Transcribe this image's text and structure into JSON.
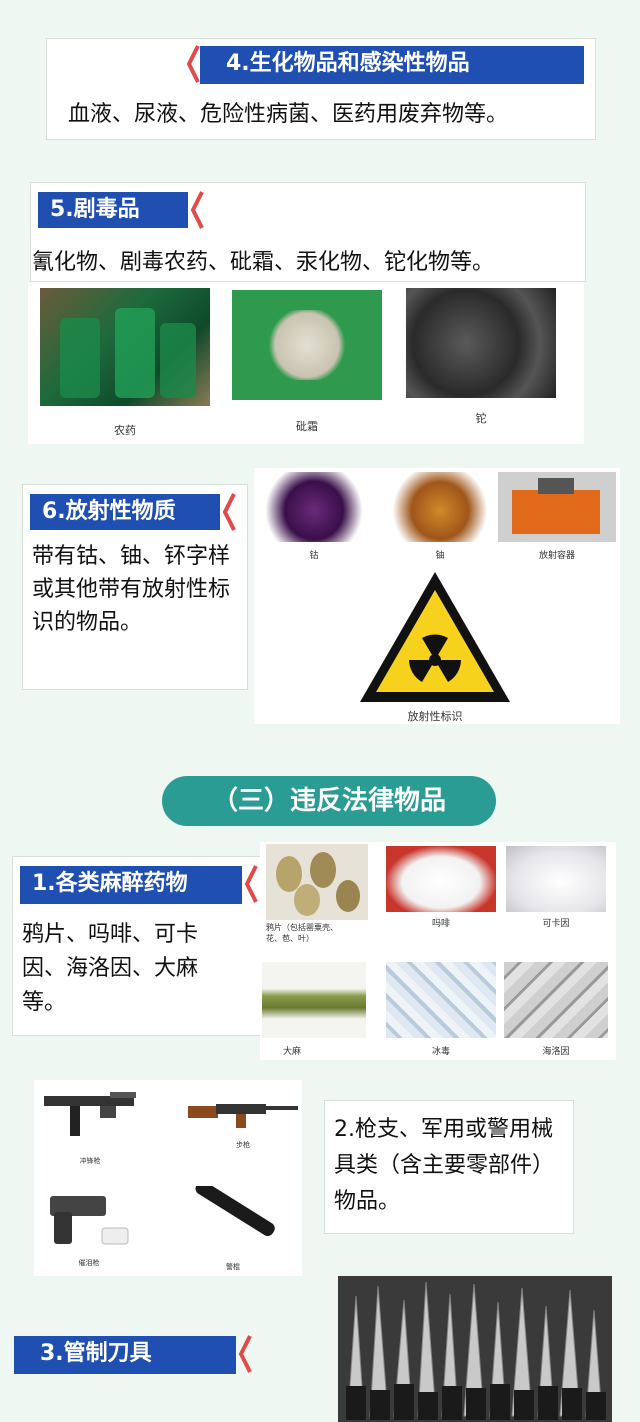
{
  "sec4": {
    "title": "4.生化物品和感染性物品",
    "text": "血液、尿液、危险性病菌、医药用废弃物等。"
  },
  "sec5": {
    "title": "5.剧毒品",
    "text": "氰化物、剧毒农药、砒霜、汞化物、铊化物等。",
    "captions": [
      "农药",
      "砒霜",
      "铊"
    ]
  },
  "sec6": {
    "title": "6.放射性物质",
    "text": "带有钴、铀、钚字样或其他带有放射性标识的物品。",
    "captions": [
      "钴",
      "铀",
      "放射容器",
      "放射性标识"
    ]
  },
  "section3": {
    "title": "（三）违反法律物品"
  },
  "sec_drugs": {
    "title": "1.各类麻醉药物",
    "text": "鸦片、吗啡、可卡因、海洛因、大麻等。",
    "captions": [
      "鸦片（包括罂粟壳、花、苞、叶）",
      "吗啡",
      "可卡因",
      "大麻",
      "冰毒",
      "海洛因"
    ]
  },
  "sec_guns": {
    "text": "2.枪支、军用或警用械具类（含主要零部件）物品。",
    "captions": [
      "冲锋枪",
      "步枪",
      "催泪枪",
      "警棍"
    ]
  },
  "sec_knives": {
    "title": "3.管制刀具"
  },
  "colors": {
    "header_blue": "#1f4fb0",
    "chevron_red": "#e04a4a",
    "pill_teal": "#2a9c93",
    "bg": "#eef7f1"
  }
}
